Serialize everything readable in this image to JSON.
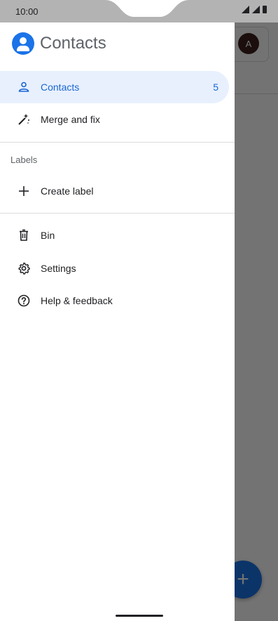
{
  "status_bar": {
    "time": "10:00"
  },
  "background_app": {
    "avatar_letter": "A",
    "fab_label": "+"
  },
  "drawer": {
    "title": "Contacts",
    "items": [
      {
        "label": "Contacts",
        "count": "5",
        "icon": "person-icon",
        "active": true
      },
      {
        "label": "Merge and fix",
        "icon": "magic-wand-icon"
      }
    ],
    "labels_section": "Labels",
    "create_label": "Create label",
    "bottom_items": [
      {
        "label": "Bin",
        "icon": "trash-icon"
      },
      {
        "label": "Settings",
        "icon": "gear-icon"
      },
      {
        "label": "Help & feedback",
        "icon": "help-icon"
      }
    ]
  },
  "colors": {
    "accent": "#1a73e8",
    "active_bg": "#e8f0fe",
    "active_text": "#1967d2"
  }
}
